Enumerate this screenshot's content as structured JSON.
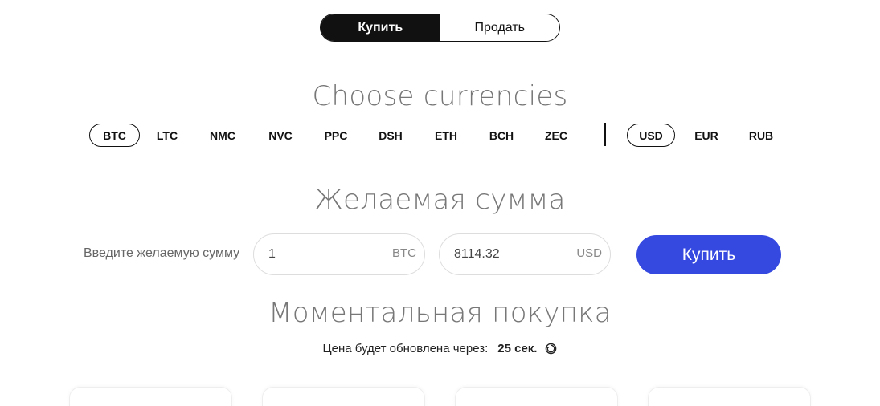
{
  "mode_toggle": {
    "buy_label": "Купить",
    "sell_label": "Продать",
    "active": "buy"
  },
  "currency_section": {
    "title": "Choose currencies",
    "crypto": [
      "BTC",
      "LTC",
      "NMC",
      "NVC",
      "PPC",
      "DSH",
      "ETH",
      "BCH",
      "ZEC"
    ],
    "selected_crypto": "BTC",
    "fiat": [
      "USD",
      "EUR",
      "RUB"
    ],
    "selected_fiat": "USD"
  },
  "amount_section": {
    "title": "Желаемая сумма",
    "label": "Введите желаемую сумму",
    "crypto_value": "1",
    "crypto_unit": "BTC",
    "fiat_value": "8114.32",
    "fiat_unit": "USD",
    "buy_button": "Купить"
  },
  "instant_section": {
    "title": "Моментальная покупка",
    "refresh_text": "Цена будет обновлена через:",
    "refresh_seconds": "25 сек.",
    "refresh_icon": "sync-icon"
  },
  "colors": {
    "accent": "#3549e0",
    "dark": "#111111",
    "muted": "#777777"
  }
}
